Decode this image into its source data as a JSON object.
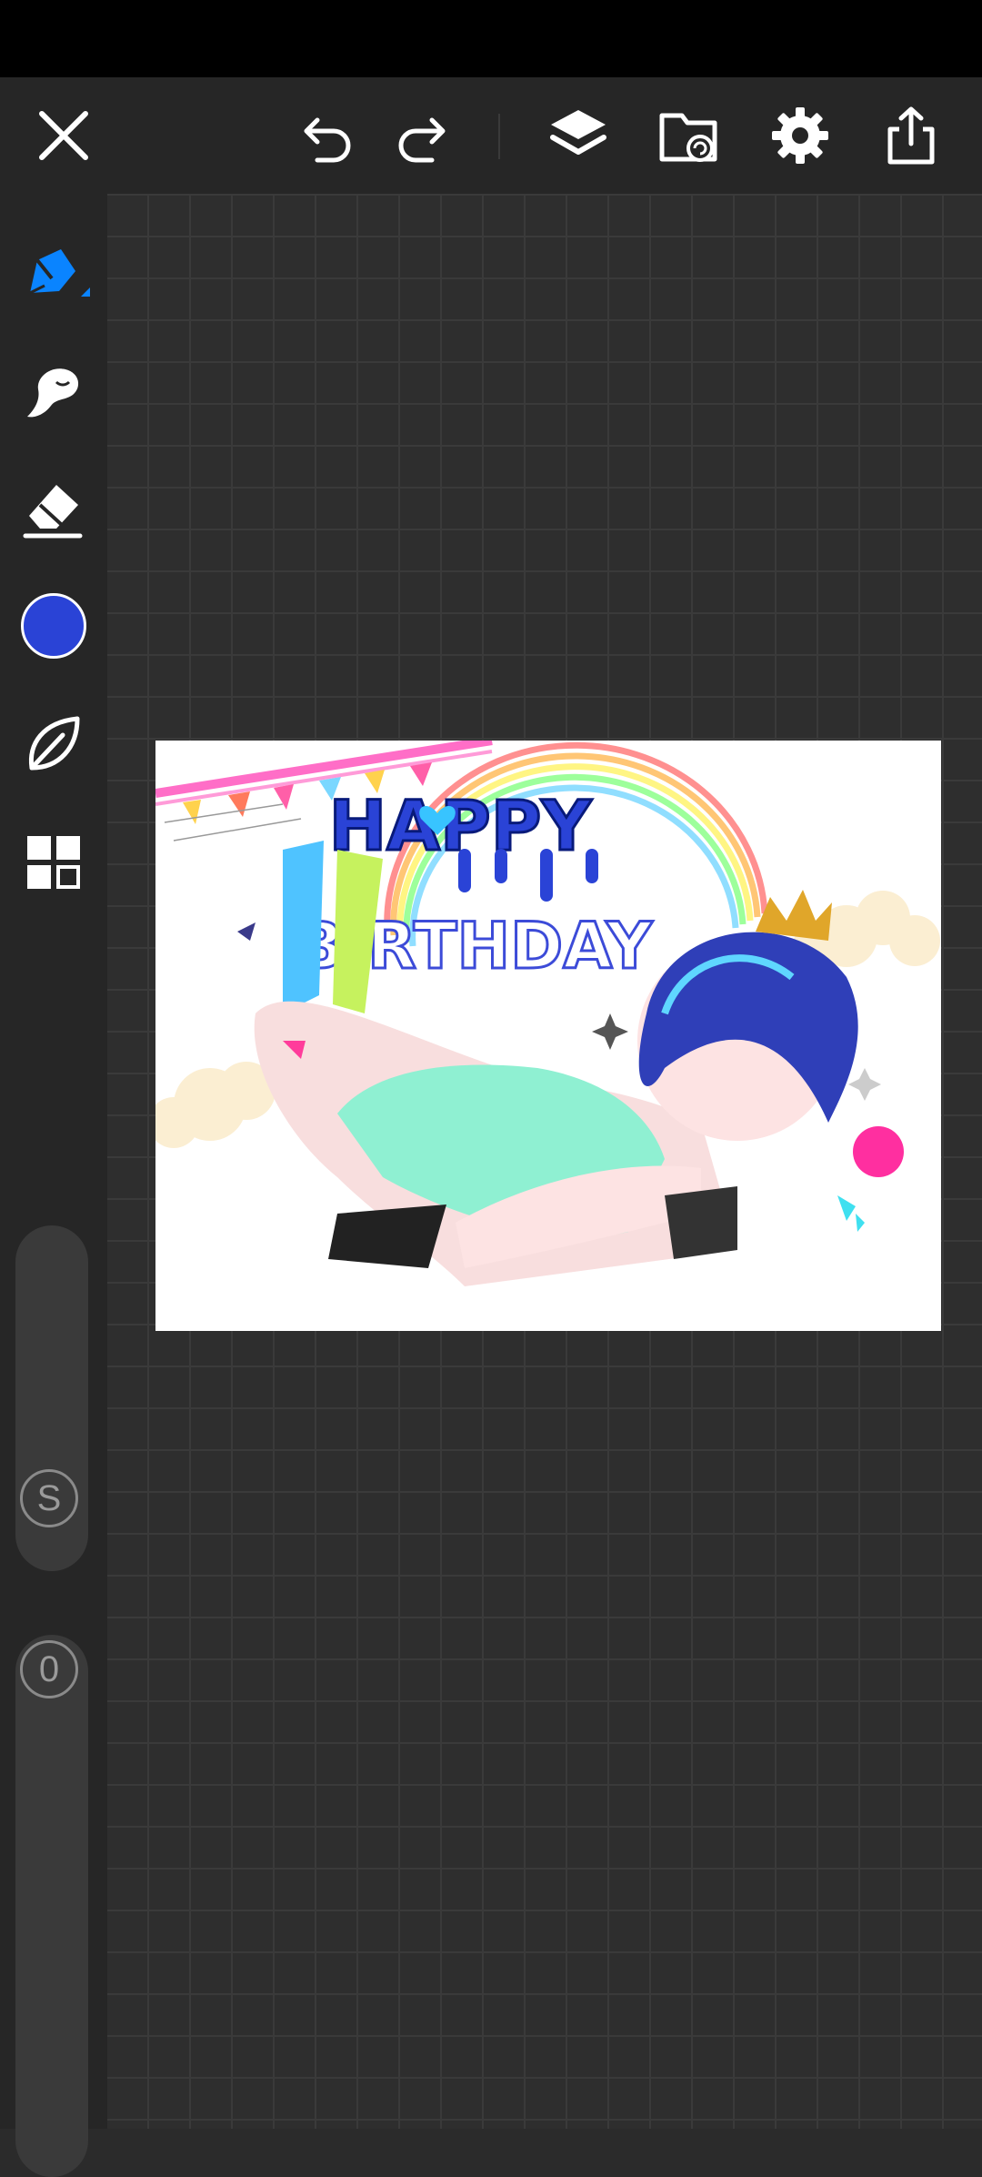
{
  "toolbar": {
    "icons": [
      "close-icon",
      "undo-icon",
      "redo-icon",
      "layers-icon",
      "gallery-icon",
      "settings-icon",
      "share-icon"
    ]
  },
  "sidebar": {
    "tools": [
      "pen-tool-icon",
      "smudge-tool-icon",
      "eraser-tool-icon",
      "color-picker",
      "brush-library-icon",
      "more-tools-icon"
    ],
    "current_color": "#2a43d6",
    "size_label": "S",
    "opacity_label": "0"
  },
  "artwork": {
    "title_top": "HAPPY",
    "title_bottom": "BIRTHDAY"
  }
}
